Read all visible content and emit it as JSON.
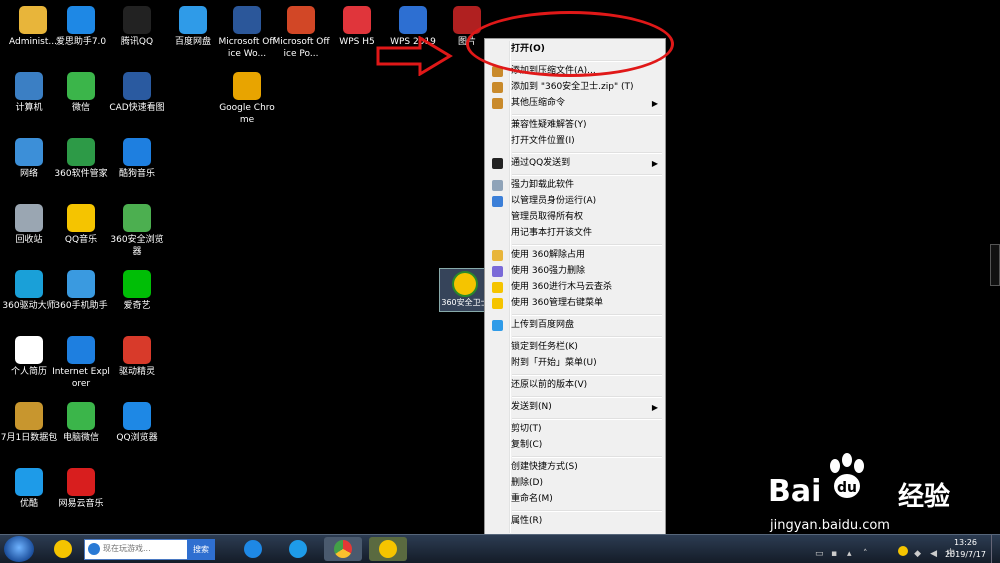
{
  "desktop_icons": [
    {
      "label": "Administ...",
      "color": "#e8b53a"
    },
    {
      "label": "爱思助手7.0",
      "color": "#1e88e5"
    },
    {
      "label": "腾讯QQ",
      "color": "#222222"
    },
    {
      "label": "百度网盘",
      "color": "#2f9be8"
    },
    {
      "label": "Microsoft Office Wo...",
      "color": "#2b579a"
    },
    {
      "label": "Microsoft Office Po...",
      "color": "#d24726"
    },
    {
      "label": "WPS H5",
      "color": "#e0353b"
    },
    {
      "label": "WPS 2019",
      "color": "#2d6fd2"
    },
    {
      "label": "图片",
      "color": "#b02020"
    },
    {
      "label": "计算机",
      "color": "#3b7fc4"
    },
    {
      "label": "微信",
      "color": "#3bb54a"
    },
    {
      "label": "CAD快速看图",
      "color": "#2a5aa0"
    },
    {
      "label": "Google Chrome",
      "color": "#e8a400"
    },
    {
      "label": "网络",
      "color": "#3c8fd8"
    },
    {
      "label": "360软件管家",
      "color": "#2d9a47"
    },
    {
      "label": "酷狗音乐",
      "color": "#1e7fe0"
    },
    {
      "label": "回收站",
      "color": "#9aa6b2"
    },
    {
      "label": "QQ音乐",
      "color": "#f5c400"
    },
    {
      "label": "360安全浏览器",
      "color": "#4caf50"
    },
    {
      "label": "360驱动大师",
      "color": "#1aa0d8"
    },
    {
      "label": "360手机助手",
      "color": "#3a9ae0"
    },
    {
      "label": "爱奇艺",
      "color": "#00be06"
    },
    {
      "label": "个人简历",
      "color": "#ffffff"
    },
    {
      "label": "Internet Explorer",
      "color": "#1e7fe0"
    },
    {
      "label": "驱动精灵",
      "color": "#d83a2a"
    },
    {
      "label": "7月1日数据包",
      "color": "#c8962e"
    },
    {
      "label": "电脑微信",
      "color": "#3bb54a"
    },
    {
      "label": "QQ浏览器",
      "color": "#1e88e5"
    },
    {
      "label": "优酷",
      "color": "#1e9be8"
    },
    {
      "label": "网易云音乐",
      "color": "#d81e1e"
    }
  ],
  "selected_icon": {
    "label": "360安全卫士"
  },
  "context_menu": {
    "items": [
      {
        "label": "打开(O)",
        "bold": true,
        "icon": "",
        "submenu": false
      },
      {
        "label": "添加到压缩文件(A)...",
        "icon": "archive-icon",
        "submenu": false
      },
      {
        "label": "添加到 \"360安全卫士.zip\" (T)",
        "icon": "archive-icon",
        "submenu": false
      },
      {
        "label": "其他压缩命令",
        "icon": "archive-icon",
        "submenu": true
      },
      {
        "label": "兼容性疑难解答(Y)",
        "icon": "",
        "submenu": false
      },
      {
        "label": "打开文件位置(I)",
        "icon": "",
        "submenu": false
      },
      {
        "label": "通过QQ发送到",
        "icon": "qq-icon",
        "submenu": true
      },
      {
        "label": "强力卸载此软件",
        "icon": "trash-icon",
        "submenu": false
      },
      {
        "label": "以管理员身份运行(A)",
        "icon": "shield-icon",
        "submenu": false
      },
      {
        "label": "管理员取得所有权",
        "icon": "",
        "submenu": false
      },
      {
        "label": "用记事本打开该文件",
        "icon": "",
        "submenu": false
      },
      {
        "label": "使用 360解除占用",
        "icon": "folder-icon",
        "submenu": false
      },
      {
        "label": "使用 360强力删除",
        "icon": "delete-icon",
        "submenu": false
      },
      {
        "label": "使用 360进行木马云查杀",
        "icon": "360-icon",
        "submenu": false
      },
      {
        "label": "使用 360管理右键菜单",
        "icon": "360-icon",
        "submenu": false
      },
      {
        "label": "上传到百度网盘",
        "icon": "baidu-pan-icon",
        "submenu": false
      },
      {
        "label": "锁定到任务栏(K)",
        "icon": "",
        "submenu": false
      },
      {
        "label": "附到「开始」菜单(U)",
        "icon": "",
        "submenu": false
      },
      {
        "label": "还原以前的版本(V)",
        "icon": "",
        "submenu": false
      },
      {
        "label": "发送到(N)",
        "icon": "",
        "submenu": true
      },
      {
        "label": "剪切(T)",
        "icon": "",
        "submenu": false
      },
      {
        "label": "复制(C)",
        "icon": "",
        "submenu": false
      },
      {
        "label": "创建快捷方式(S)",
        "icon": "",
        "submenu": false
      },
      {
        "label": "删除(D)",
        "icon": "",
        "submenu": false
      },
      {
        "label": "重命名(M)",
        "icon": "",
        "submenu": false
      },
      {
        "label": "属性(R)",
        "icon": "",
        "submenu": false
      }
    ],
    "submenu_glyph": "▶"
  },
  "taskbar": {
    "search_placeholder": "现在玩游戏...",
    "search_button": "搜索",
    "time": "13:26",
    "date": "2019/7/17"
  },
  "watermark": {
    "brand_left": "Bai",
    "brand_right": "经验",
    "url": "jingyan.baidu.com"
  },
  "colors": {
    "annotation_red": "#e01818",
    "menu_bg": "#f0f0f0",
    "taskbar_bg": "#1c2838"
  }
}
